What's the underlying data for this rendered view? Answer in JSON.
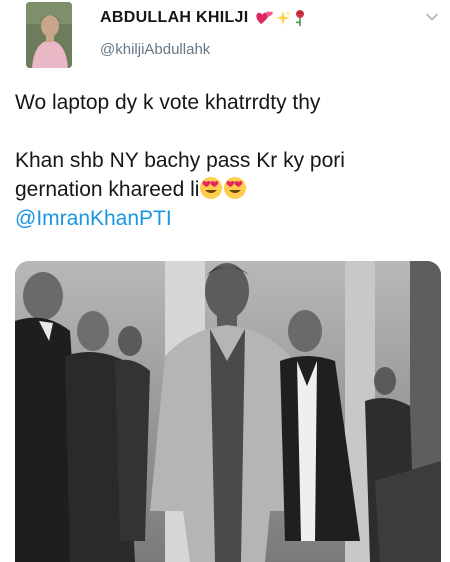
{
  "tweet": {
    "author": {
      "display_name": "ABDULLAH KHILJI",
      "handle": "@khiljiAbdullahk",
      "name_emojis": [
        "two-hearts-icon",
        "sparkles-icon",
        "rose-icon"
      ]
    },
    "menu_icon": "chevron-down-icon",
    "text_line_1": "Wo laptop dy k vote khatrrdty thy",
    "text_line_2": "Khan shb NY bachy pass Kr ky pori",
    "text_line_3": "gernation khareed li",
    "text_emojis": [
      "heart-eyes-icon",
      "heart-eyes-icon"
    ],
    "mention": "@ImranKhanPTI",
    "media": {
      "type": "photo",
      "description_icon": "photo-icon"
    }
  },
  "colors": {
    "text": "#14171a",
    "secondary": "#657786",
    "link": "#1b95e0"
  }
}
